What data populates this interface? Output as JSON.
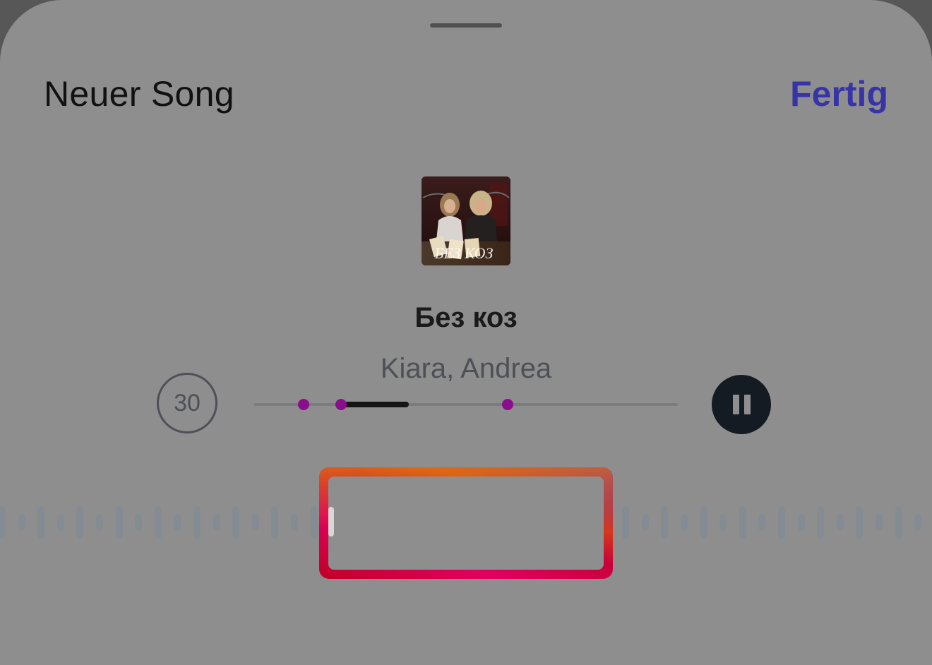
{
  "header": {
    "title": "Neuer Song",
    "done_label": "Fertig"
  },
  "song": {
    "title": "Без коз",
    "artists": "Kiara, Andrea",
    "artwork_text": "БЕЗ КОЗ",
    "artwork_label": "artwork-icon"
  },
  "controls": {
    "clip_duration": "30",
    "pause_icon": "pause-icon",
    "progress": {
      "start_fraction": 0.205,
      "end_fraction": 0.365
    },
    "markers": [
      0.116,
      0.205,
      0.598
    ]
  },
  "selection": {
    "handle_icon": "drag-handle-icon"
  },
  "colors": {
    "accent": "#3634a6",
    "marker": "#8a0e8c",
    "background": "#8e8e8e"
  }
}
